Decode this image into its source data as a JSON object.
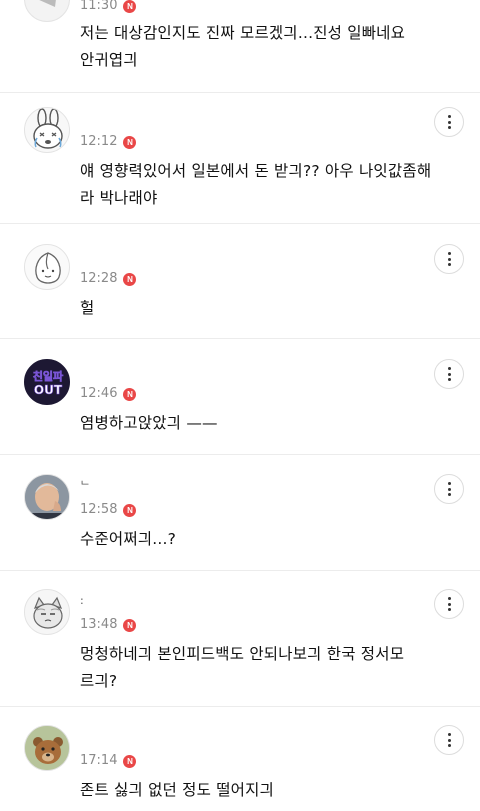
{
  "comments": [
    {
      "nickname": "",
      "time": "11:30",
      "badge": "N",
      "text": "저는 대상감인지도 진짜 모르겠긔...진성 일빠네요\n안귀엽긔",
      "avatar": "partial-avatar-icon"
    },
    {
      "nickname": "",
      "time": "12:12",
      "badge": "N",
      "text": "얘 영향력있어서 일본에서 돈 받긔?? 아우 나잇값좀해\n라 박나래야",
      "avatar": "bunny-crying-avatar-icon"
    },
    {
      "nickname": "",
      "time": "12:28",
      "badge": "N",
      "text": "헐",
      "avatar": "peach-character-avatar-icon"
    },
    {
      "nickname": "",
      "time": "12:46",
      "badge": "N",
      "text": "염병하고앉았긔 ——",
      "avatar": "chinilpa-out-avatar",
      "avatar_text": [
        "친일파",
        "OUT"
      ]
    },
    {
      "nickname": "ᄂ",
      "time": "12:58",
      "badge": "N",
      "text": "수준어쩌긔...?",
      "avatar": "person-photo-avatar"
    },
    {
      "nickname": ":",
      "time": "13:48",
      "badge": "N",
      "text": "멍청하네긔 본인피드백도 안되나보긔 한국 정서모\n르긔?",
      "avatar": "cat-character-avatar-icon"
    },
    {
      "nickname": "",
      "time": "17:14",
      "badge": "N",
      "text": "존트 싫긔 없던 정도 떨어지긔",
      "avatar": "bear-photo-avatar"
    }
  ],
  "colors": {
    "badge": "#e94747",
    "time": "#8a8a8a",
    "divider": "#ececec"
  }
}
